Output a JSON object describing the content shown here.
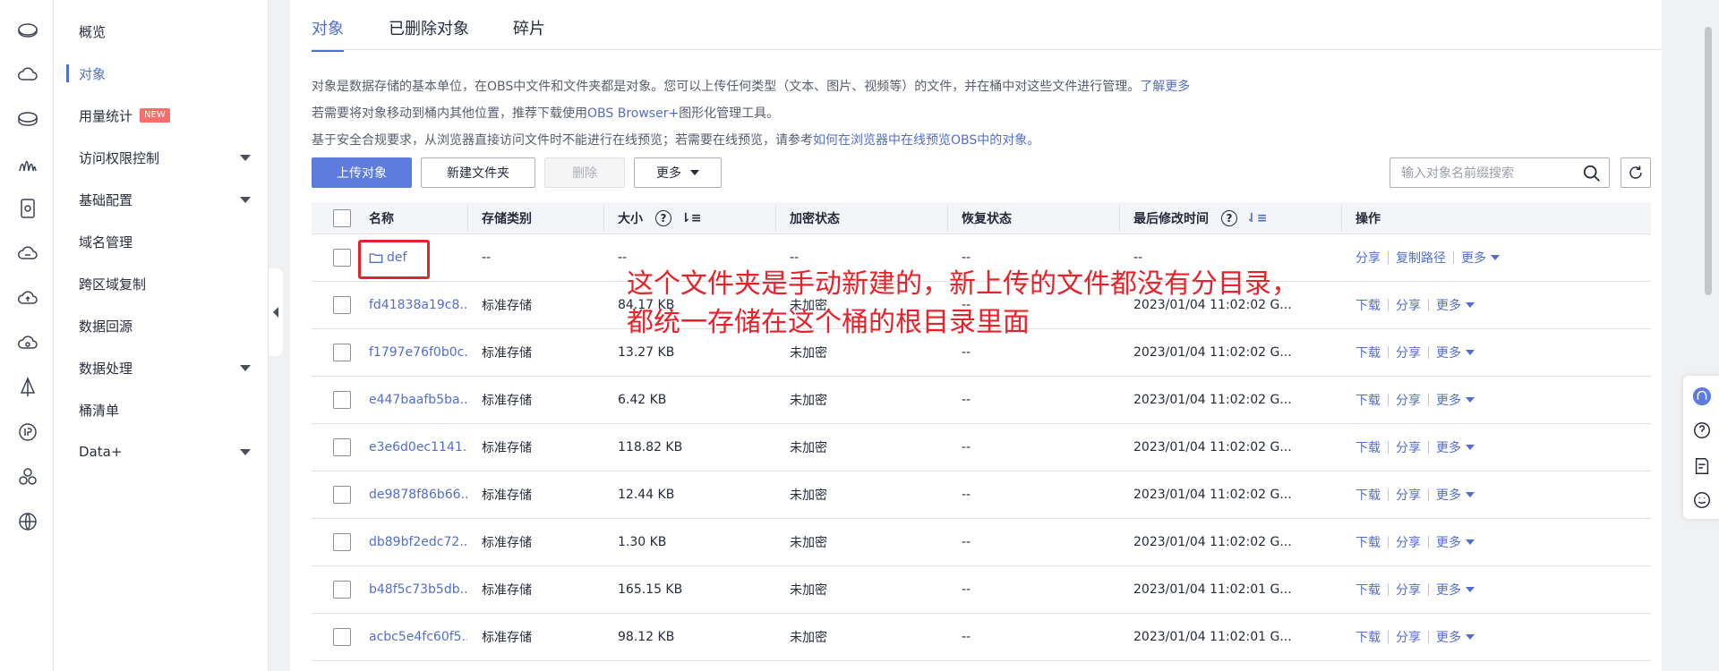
{
  "rail_icons": [
    "bucket-icon",
    "cloud-icon",
    "storage-icon",
    "analytics-icon",
    "device-icon",
    "cloud-sync-icon",
    "cloud-upload-icon",
    "cloud-settings-icon",
    "sail-icon",
    "ip-icon",
    "cluster-icon",
    "globe-icon"
  ],
  "nav": {
    "items": [
      {
        "label": "概览"
      },
      {
        "label": "对象",
        "active": true
      },
      {
        "label": "用量统计",
        "badge": "NEW"
      },
      {
        "label": "访问权限控制",
        "expandable": true
      },
      {
        "label": "基础配置",
        "expandable": true
      },
      {
        "label": "域名管理"
      },
      {
        "label": "跨区域复制"
      },
      {
        "label": "数据回源"
      },
      {
        "label": "数据处理",
        "expandable": true
      },
      {
        "label": "桶清单"
      },
      {
        "label": "Data+",
        "expandable": true
      }
    ]
  },
  "tabs": [
    {
      "label": "对象",
      "active": true
    },
    {
      "label": "已删除对象"
    },
    {
      "label": "碎片"
    }
  ],
  "description": {
    "line1_text": "对象是数据存储的基本单位，在OBS中文件和文件夹都是对象。您可以上传任何类型（文本、图片、视频等）的文件，并在桶中对这些文件进行管理。",
    "line1_link": "了解更多",
    "line2_text_a": "若需要将对象移动到桶内其他位置，推荐下载使用",
    "line2_link": "OBS Browser+",
    "line2_text_b": "图形化管理工具。",
    "line3_text": "基于安全合规要求，从浏览器直接访问文件时不能进行在线预览；若需要在线预览，请参考",
    "line3_link": "如何在浏览器中在线预览OBS中的对象。"
  },
  "toolbar": {
    "upload": "上传对象",
    "new_folder": "新建文件夹",
    "delete": "删除",
    "more": "更多"
  },
  "search": {
    "placeholder": "输入对象名前缀搜索"
  },
  "table": {
    "headers": {
      "name": "名称",
      "storage_class": "存储类别",
      "size": "大小",
      "encryption": "加密状态",
      "restore": "恢复状态",
      "modified": "最后修改时间",
      "ops": "操作"
    },
    "rows": [
      {
        "name": "def",
        "is_folder": true,
        "storage_class": "--",
        "size": "--",
        "encryption": "--",
        "restore": "--",
        "modified": "--",
        "ops": [
          "分享",
          "复制路径",
          "更多"
        ]
      },
      {
        "name": "fd41838a19c8...",
        "storage_class": "标准存储",
        "size": "84.17 KB",
        "encryption": "未加密",
        "restore": "--",
        "modified": "2023/01/04 11:02:02 G...",
        "ops": [
          "下载",
          "分享",
          "更多"
        ]
      },
      {
        "name": "f1797e76f0b0c...",
        "storage_class": "标准存储",
        "size": "13.27 KB",
        "encryption": "未加密",
        "restore": "--",
        "modified": "2023/01/04 11:02:02 G...",
        "ops": [
          "下载",
          "分享",
          "更多"
        ]
      },
      {
        "name": "e447baafb5ba...",
        "storage_class": "标准存储",
        "size": "6.42 KB",
        "encryption": "未加密",
        "restore": "--",
        "modified": "2023/01/04 11:02:02 G...",
        "ops": [
          "下载",
          "分享",
          "更多"
        ]
      },
      {
        "name": "e3e6d0ec1141...",
        "storage_class": "标准存储",
        "size": "118.82 KB",
        "encryption": "未加密",
        "restore": "--",
        "modified": "2023/01/04 11:02:02 G...",
        "ops": [
          "下载",
          "分享",
          "更多"
        ]
      },
      {
        "name": "de9878f86b66...",
        "storage_class": "标准存储",
        "size": "12.44 KB",
        "encryption": "未加密",
        "restore": "--",
        "modified": "2023/01/04 11:02:02 G...",
        "ops": [
          "下载",
          "分享",
          "更多"
        ]
      },
      {
        "name": "db89bf2edc72...",
        "storage_class": "标准存储",
        "size": "1.30 KB",
        "encryption": "未加密",
        "restore": "--",
        "modified": "2023/01/04 11:02:02 G...",
        "ops": [
          "下载",
          "分享",
          "更多"
        ]
      },
      {
        "name": "b48f5c73b5db...",
        "storage_class": "标准存储",
        "size": "165.15 KB",
        "encryption": "未加密",
        "restore": "--",
        "modified": "2023/01/04 11:02:01 G...",
        "ops": [
          "下载",
          "分享",
          "更多"
        ]
      },
      {
        "name": "acbc5e4fc60f5...",
        "storage_class": "标准存储",
        "size": "98.12 KB",
        "encryption": "未加密",
        "restore": "--",
        "modified": "2023/01/04 11:02:01 G...",
        "ops": [
          "下载",
          "分享",
          "更多"
        ]
      }
    ]
  },
  "annotation": {
    "line1": "这个文件夹是手动新建的，新上传的文件都没有分目录，",
    "line2": "都统一存储在这个桶的根目录里面",
    "color": "#e8222a"
  },
  "float_tools": [
    "customer-service-icon",
    "help-icon",
    "feedback-icon",
    "smile-icon"
  ],
  "colors": {
    "accent": "#526ecc",
    "primary_button": "#5e7ce0"
  }
}
